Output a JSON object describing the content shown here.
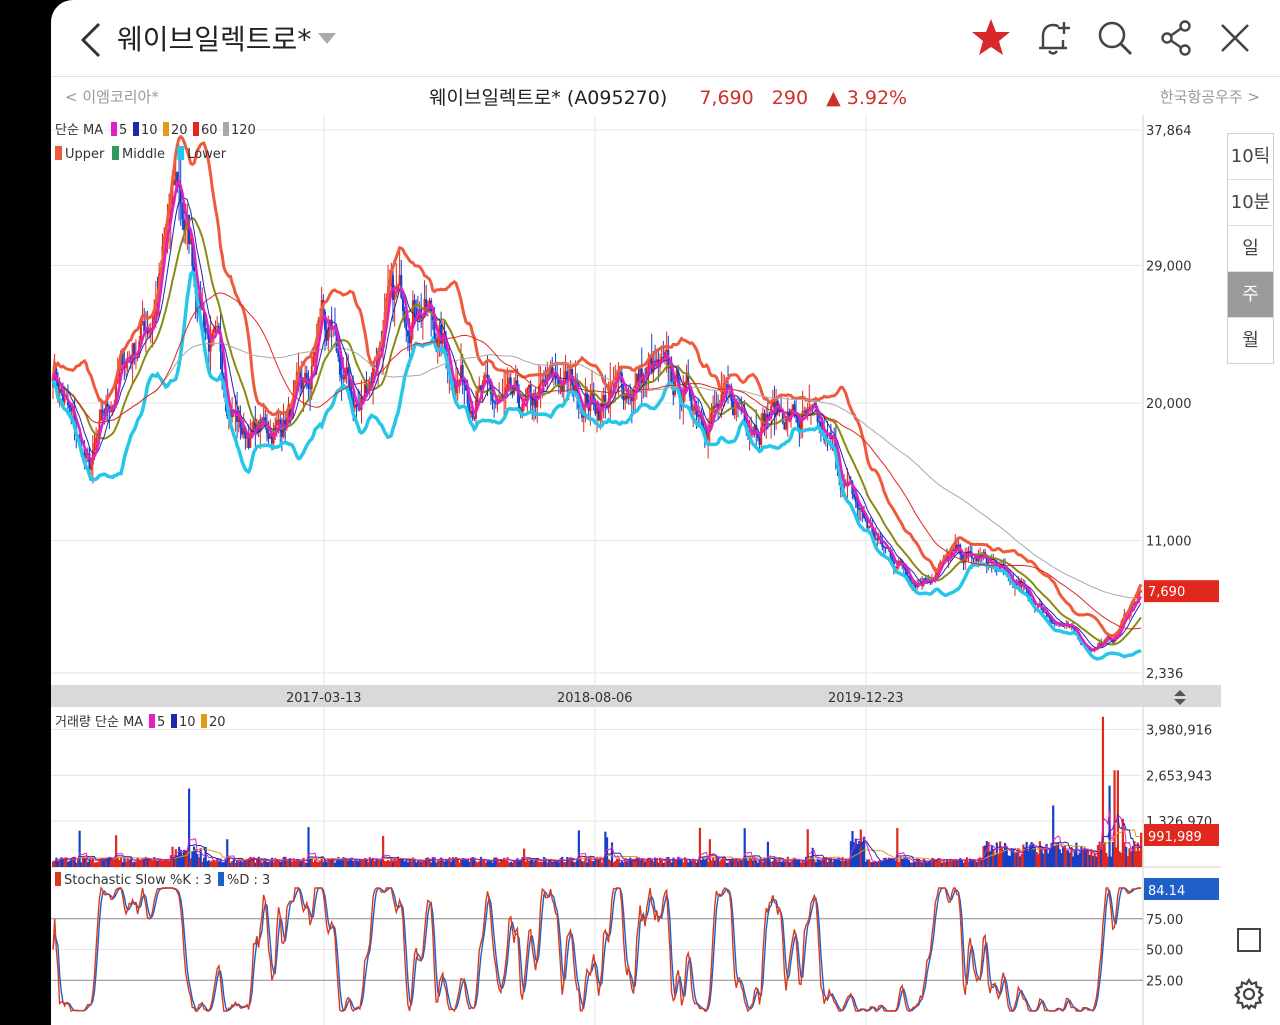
{
  "header": {
    "title": "웨이브일렉트로*"
  },
  "subheader": {
    "prev_stock": "이엠코리아*",
    "stock_name": "웨이브일렉트로* (A095270)",
    "price": "7,690",
    "change": "290",
    "change_pct": "3.92%",
    "next_stock": "한국항공우주"
  },
  "periods": [
    "10틱",
    "10분",
    "일",
    "주",
    "월"
  ],
  "selected_period": "주",
  "colors": {
    "up": "#e0281e",
    "down": "#1540c8",
    "accent": "#e0281e"
  },
  "chart_data": [
    {
      "type": "candlestick",
      "panel": "price",
      "legend_row1": "단순 MA",
      "ma_series": [
        {
          "name": "5",
          "color": "#e020c0"
        },
        {
          "name": "10",
          "color": "#1a2aa8"
        },
        {
          "name": "20",
          "color": "#e09c14"
        },
        {
          "name": "60",
          "color": "#e0281e"
        },
        {
          "name": "120",
          "color": "#a8a8a8"
        }
      ],
      "bollinger_series": [
        {
          "name": "Upper",
          "color": "#f05a3c"
        },
        {
          "name": "Middle",
          "color": "#2e9a5c"
        },
        {
          "name": "Lower",
          "color": "#26c6e8"
        }
      ],
      "y_ticks": [
        "37,864",
        "29,000",
        "20,000",
        "11,000",
        "2,336"
      ],
      "x_ticks": [
        "2017-03-13",
        "2018-08-06",
        "2019-12-23"
      ],
      "current_value": "7,690",
      "ylim": [
        2336,
        37864
      ]
    },
    {
      "type": "bar",
      "panel": "volume",
      "legend": "거래량 단순 MA",
      "ma_series": [
        {
          "name": "5",
          "color": "#e020c0"
        },
        {
          "name": "10",
          "color": "#1a2aa8"
        },
        {
          "name": "20",
          "color": "#e09c14"
        }
      ],
      "y_ticks": [
        "3,980,916",
        "2,653,943",
        "1,326,970"
      ],
      "current_value": "991,989"
    },
    {
      "type": "line",
      "panel": "stochastic",
      "series": [
        {
          "name": "Stochastic Slow %K : 3",
          "color": "#d83a1e"
        },
        {
          "name": "%D : 3",
          "color": "#1f5fc8"
        }
      ],
      "y_ticks": [
        "75.00",
        "50.00",
        "25.00"
      ],
      "current_value": "84.14",
      "ylim": [
        0,
        100
      ]
    }
  ]
}
